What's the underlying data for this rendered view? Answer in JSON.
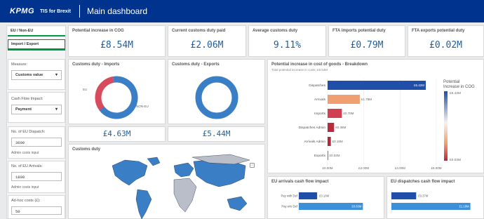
{
  "header": {
    "logo": "KPMG",
    "app_name": "TIS for Brexit",
    "title": "Main dashboard"
  },
  "sidebar": {
    "tab1": "EU / Non-EU",
    "tab2": "Import / Export",
    "measure_label": "Measure:",
    "measure_value": "Customs value",
    "cashflow_label": "Cash Flow Impact:",
    "cashflow_value": "Payment",
    "dispatch_label": "No. of EU Dispatch:",
    "dispatch_value": "3600",
    "dispatch_caption": "Admin costs input",
    "arrivals_label": "No. of EU Arrivals:",
    "arrivals_value": "1800",
    "arrivals_caption": "Admin costs input",
    "adhoc_label": "Ad-hoc costs (£):",
    "adhoc_value": "50"
  },
  "kpis": [
    {
      "title": "Potential increase in COG",
      "value": "£8.54M"
    },
    {
      "title": "Current customs duty paid",
      "value": "£2.06M"
    },
    {
      "title": "Average customs duty",
      "value": "9.11%"
    },
    {
      "title": "FTA imports potential duty",
      "value": "£0.79M"
    },
    {
      "title": "FTA exports potential duty",
      "value": "£0.02M"
    }
  ],
  "donut_imports": {
    "title": "Customs duty - Imports",
    "value": "£4.63M",
    "label_eu": "EU",
    "label_noneu": "NON-EU"
  },
  "donut_exports": {
    "title": "Customs duty - Exports",
    "value": "£5.44M"
  },
  "map": {
    "title": "Customs duty"
  },
  "colors": {
    "header": "#00338d",
    "accent_blue": "#1f5fa0",
    "accent_green": "#009a44"
  },
  "chart_data": [
    {
      "type": "pie",
      "title": "Customs duty - Imports",
      "categories": [
        "EU",
        "NON-EU"
      ],
      "values": [
        0.33,
        0.67
      ]
    },
    {
      "type": "pie",
      "title": "Customs duty - Exports",
      "categories": [
        "NON-EU"
      ],
      "values": [
        1.0
      ]
    },
    {
      "type": "bar",
      "orientation": "horizontal",
      "title": "Potential increase in cost of goods - Breakdown",
      "subtitle": "Total potential increase in costs: £8.54M",
      "categories": [
        "Dispatches",
        "Arrivals",
        "Imports",
        "Dispatches Admin",
        "Arrivals Admin",
        "Exports"
      ],
      "values": [
        5.42,
        1.78,
        0.79,
        0.36,
        0.18,
        0.02
      ],
      "data_labels": [
        "£5.42M",
        "£1.78M",
        "£0.79M",
        "£0.36M",
        "£0.18M",
        "£0.02M"
      ],
      "xticks": [
        "£0.00M",
        "£2.00M",
        "£4.00M",
        "£6.00M"
      ],
      "xlim": [
        0,
        6
      ],
      "colors": [
        "#1f4fa8",
        "#f0a070",
        "#d04050",
        "#b82a3e",
        "#b0283c",
        "#b82840"
      ],
      "legend": {
        "title": "Potential Increase in COG",
        "max": "£5.42M",
        "min": "£0.02M"
      }
    },
    {
      "type": "bar",
      "orientation": "horizontal",
      "title": "EU arrivals cash flow impact",
      "categories": [
        "Pay with Def",
        "Pay w/o Def"
      ],
      "values": [
        0.18,
        0.63
      ],
      "data_labels": [
        "£0.18M",
        "£0.63M"
      ],
      "xlim": [
        0,
        0.8
      ]
    },
    {
      "type": "bar",
      "orientation": "horizontal",
      "title": "EU dispatches cash flow impact",
      "categories": [
        "",
        ""
      ],
      "values": [
        0.37,
        1.18
      ],
      "data_labels": [
        "£0.37M",
        "£1.18M"
      ],
      "xlim": [
        0,
        1.3
      ]
    }
  ]
}
